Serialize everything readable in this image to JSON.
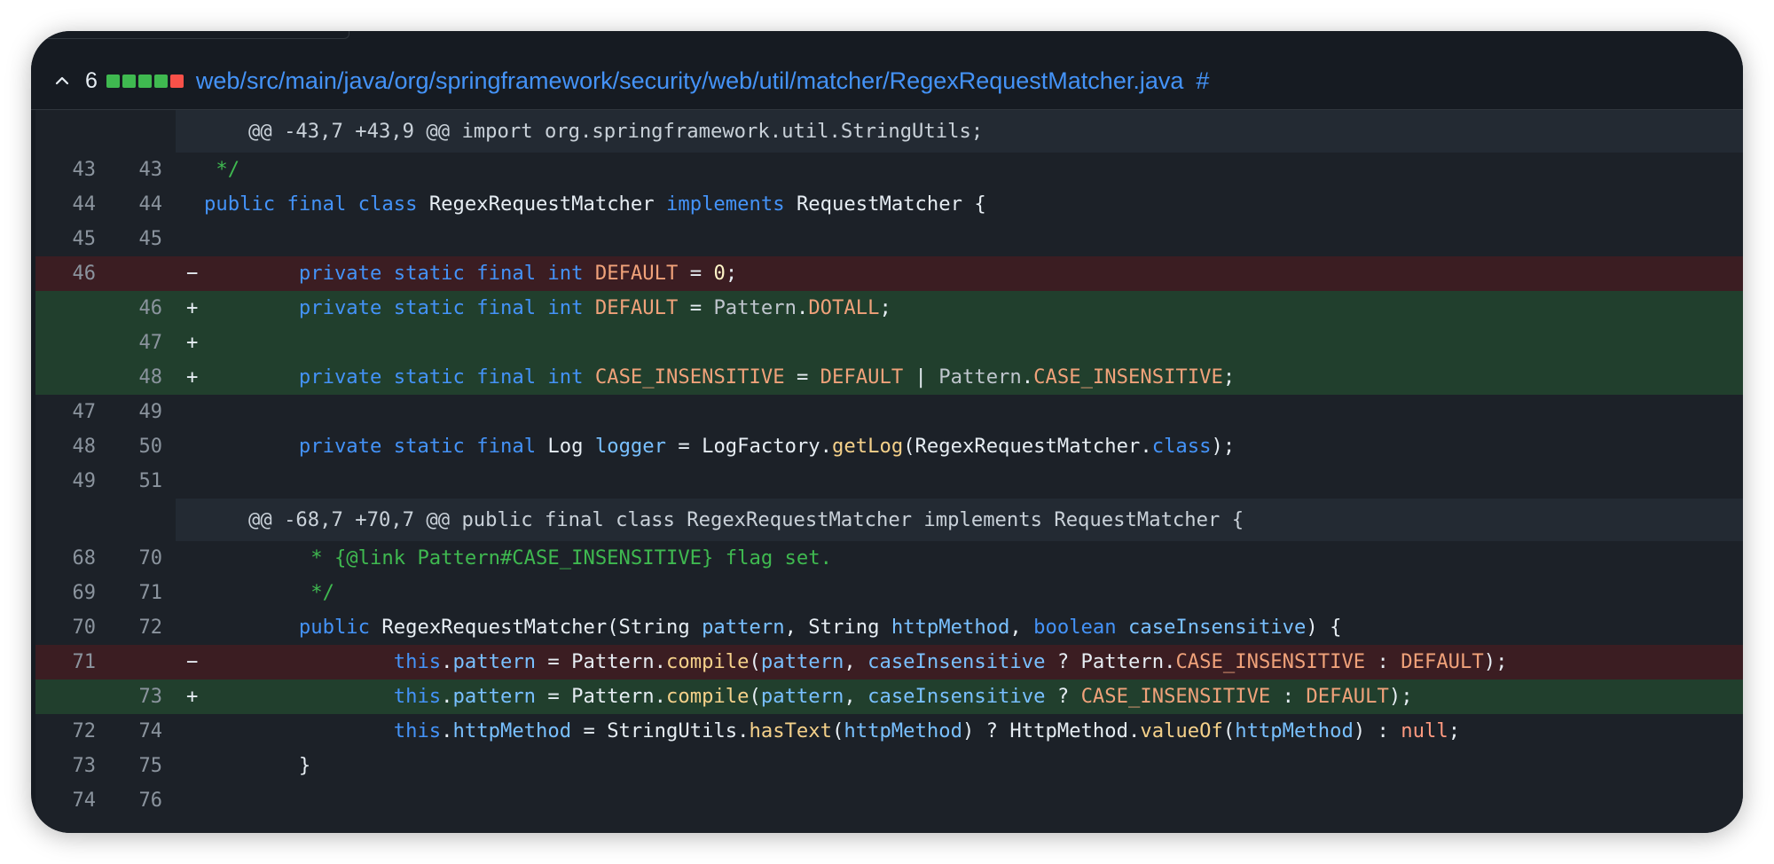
{
  "header": {
    "change_count": "6",
    "diffstat": [
      "add",
      "add",
      "add",
      "add",
      "del"
    ],
    "file_path": "web/src/main/java/org/springframework/security/web/util/matcher/RegexRequestMatcher.java",
    "anchor": "#"
  },
  "colors": {
    "add_bg": "#213f2d",
    "del_bg": "#3b1d22",
    "link": "#4493f8",
    "stat_add": "#3fb950",
    "stat_del": "#f85149"
  },
  "rows": [
    {
      "type": "hunk",
      "text": "@@ -43,7 +43,9 @@ import org.springframework.util.StringUtils;"
    },
    {
      "type": "ctx",
      "old": "43",
      "new": "43",
      "sign": "",
      "tokens": [
        [
          "t-cm",
          " */"
        ]
      ]
    },
    {
      "type": "ctx",
      "old": "44",
      "new": "44",
      "sign": "",
      "tokens": [
        [
          "t-kw",
          "public"
        ],
        [
          "t-pl",
          " "
        ],
        [
          "t-kw",
          "final"
        ],
        [
          "t-pl",
          " "
        ],
        [
          "t-kw",
          "class"
        ],
        [
          "t-pl",
          " RegexRequestMatcher "
        ],
        [
          "t-kw",
          "implements"
        ],
        [
          "t-pl",
          " RequestMatcher {"
        ]
      ]
    },
    {
      "type": "ctx",
      "old": "45",
      "new": "45",
      "sign": "",
      "tokens": []
    },
    {
      "type": "del",
      "old": "46",
      "new": "",
      "sign": "−",
      "tokens": [
        [
          "t-pl",
          "        "
        ],
        [
          "t-kw",
          "private"
        ],
        [
          "t-pl",
          " "
        ],
        [
          "t-kw",
          "static"
        ],
        [
          "t-pl",
          " "
        ],
        [
          "t-kw",
          "final"
        ],
        [
          "t-pl",
          " "
        ],
        [
          "t-kw",
          "int"
        ],
        [
          "t-pl",
          " "
        ],
        [
          "t-cn",
          "DEFAULT"
        ],
        [
          "t-pl",
          " = "
        ],
        [
          "t-nu",
          "0"
        ],
        [
          "t-pl",
          ";"
        ]
      ]
    },
    {
      "type": "add",
      "old": "",
      "new": "46",
      "sign": "+",
      "tokens": [
        [
          "t-pl",
          "        "
        ],
        [
          "t-kw",
          "private"
        ],
        [
          "t-pl",
          " "
        ],
        [
          "t-kw",
          "static"
        ],
        [
          "t-pl",
          " "
        ],
        [
          "t-kw",
          "final"
        ],
        [
          "t-pl",
          " "
        ],
        [
          "t-kw",
          "int"
        ],
        [
          "t-pl",
          " "
        ],
        [
          "t-cn",
          "DEFAULT"
        ],
        [
          "t-pl",
          " = "
        ],
        [
          "t-mu",
          "Pattern"
        ],
        [
          "t-pl",
          "."
        ],
        [
          "t-cn",
          "DOTALL"
        ],
        [
          "t-pl",
          ";"
        ]
      ]
    },
    {
      "type": "add",
      "old": "",
      "new": "47",
      "sign": "+",
      "tokens": []
    },
    {
      "type": "add",
      "old": "",
      "new": "48",
      "sign": "+",
      "tokens": [
        [
          "t-pl",
          "        "
        ],
        [
          "t-kw",
          "private"
        ],
        [
          "t-pl",
          " "
        ],
        [
          "t-kw",
          "static"
        ],
        [
          "t-pl",
          " "
        ],
        [
          "t-kw",
          "final"
        ],
        [
          "t-pl",
          " "
        ],
        [
          "t-kw",
          "int"
        ],
        [
          "t-pl",
          " "
        ],
        [
          "t-cn",
          "CASE_INSENSITIVE"
        ],
        [
          "t-pl",
          " = "
        ],
        [
          "t-cn",
          "DEFAULT"
        ],
        [
          "t-pl",
          " | "
        ],
        [
          "t-mu",
          "Pattern"
        ],
        [
          "t-pl",
          "."
        ],
        [
          "t-cn",
          "CASE_INSENSITIVE"
        ],
        [
          "t-pl",
          ";"
        ]
      ]
    },
    {
      "type": "ctx",
      "old": "47",
      "new": "49",
      "sign": "",
      "tokens": []
    },
    {
      "type": "ctx",
      "old": "48",
      "new": "50",
      "sign": "",
      "tokens": [
        [
          "t-pl",
          "        "
        ],
        [
          "t-kw",
          "private"
        ],
        [
          "t-pl",
          " "
        ],
        [
          "t-kw",
          "static"
        ],
        [
          "t-pl",
          " "
        ],
        [
          "t-kw",
          "final"
        ],
        [
          "t-pl",
          " Log "
        ],
        [
          "t-pr",
          "logger"
        ],
        [
          "t-pl",
          " = LogFactory."
        ],
        [
          "t-fn",
          "getLog"
        ],
        [
          "t-pl",
          "(RegexRequestMatcher."
        ],
        [
          "t-kw",
          "class"
        ],
        [
          "t-pl",
          ");"
        ]
      ]
    },
    {
      "type": "ctx",
      "old": "49",
      "new": "51",
      "sign": "",
      "tokens": []
    },
    {
      "type": "hunk",
      "text": "@@ -68,7 +70,7 @@ public final class RegexRequestMatcher implements RequestMatcher {"
    },
    {
      "type": "ctx",
      "old": "68",
      "new": "70",
      "sign": "",
      "tokens": [
        [
          "t-cm",
          "         * {@link Pattern#CASE_INSENSITIVE} flag set."
        ]
      ]
    },
    {
      "type": "ctx",
      "old": "69",
      "new": "71",
      "sign": "",
      "tokens": [
        [
          "t-cm",
          "         */"
        ]
      ]
    },
    {
      "type": "ctx",
      "old": "70",
      "new": "72",
      "sign": "",
      "tokens": [
        [
          "t-pl",
          "        "
        ],
        [
          "t-kw",
          "public"
        ],
        [
          "t-pl",
          " RegexRequestMatcher(String "
        ],
        [
          "t-pr",
          "pattern"
        ],
        [
          "t-pl",
          ", String "
        ],
        [
          "t-pr",
          "httpMethod"
        ],
        [
          "t-pl",
          ", "
        ],
        [
          "t-kw",
          "boolean"
        ],
        [
          "t-pl",
          " "
        ],
        [
          "t-pr",
          "caseInsensitive"
        ],
        [
          "t-pl",
          ") {"
        ]
      ]
    },
    {
      "type": "del",
      "old": "71",
      "new": "",
      "sign": "−",
      "tokens": [
        [
          "t-pl",
          "                "
        ],
        [
          "t-kw",
          "this"
        ],
        [
          "t-pl",
          "."
        ],
        [
          "t-pr",
          "pattern"
        ],
        [
          "t-pl",
          " = Pattern."
        ],
        [
          "t-fn",
          "compile"
        ],
        [
          "t-pl",
          "("
        ],
        [
          "t-pr",
          "pattern"
        ],
        [
          "t-pl",
          ", "
        ],
        [
          "t-pr",
          "caseInsensitive"
        ],
        [
          "t-pl",
          " ? Pattern."
        ],
        [
          "t-cn",
          "CASE_INSENSITIVE"
        ],
        [
          "t-pl",
          " : "
        ],
        [
          "t-cn",
          "DEFAULT"
        ],
        [
          "t-pl",
          ");"
        ]
      ]
    },
    {
      "type": "add",
      "old": "",
      "new": "73",
      "sign": "+",
      "tokens": [
        [
          "t-pl",
          "                "
        ],
        [
          "t-kw",
          "this"
        ],
        [
          "t-pl",
          "."
        ],
        [
          "t-pr",
          "pattern"
        ],
        [
          "t-pl",
          " = Pattern."
        ],
        [
          "t-fn",
          "compile"
        ],
        [
          "t-pl",
          "("
        ],
        [
          "t-pr",
          "pattern"
        ],
        [
          "t-pl",
          ", "
        ],
        [
          "t-pr",
          "caseInsensitive"
        ],
        [
          "t-pl",
          " ? "
        ],
        [
          "t-cn",
          "CASE_INSENSITIVE"
        ],
        [
          "t-pl",
          " : "
        ],
        [
          "t-cn",
          "DEFAULT"
        ],
        [
          "t-pl",
          ");"
        ]
      ]
    },
    {
      "type": "ctx",
      "old": "72",
      "new": "74",
      "sign": "",
      "tokens": [
        [
          "t-pl",
          "                "
        ],
        [
          "t-kw",
          "this"
        ],
        [
          "t-pl",
          "."
        ],
        [
          "t-pr",
          "httpMethod"
        ],
        [
          "t-pl",
          " = StringUtils."
        ],
        [
          "t-fn",
          "hasText"
        ],
        [
          "t-pl",
          "("
        ],
        [
          "t-pr",
          "httpMethod"
        ],
        [
          "t-pl",
          ") ? HttpMethod."
        ],
        [
          "t-fn",
          "valueOf"
        ],
        [
          "t-pl",
          "("
        ],
        [
          "t-pr",
          "httpMethod"
        ],
        [
          "t-pl",
          ") : "
        ],
        [
          "t-nl",
          "null"
        ],
        [
          "t-pl",
          ";"
        ]
      ]
    },
    {
      "type": "ctx",
      "old": "73",
      "new": "75",
      "sign": "",
      "tokens": [
        [
          "t-pl",
          "        }"
        ]
      ]
    },
    {
      "type": "ctx",
      "old": "74",
      "new": "76",
      "sign": "",
      "tokens": []
    }
  ]
}
